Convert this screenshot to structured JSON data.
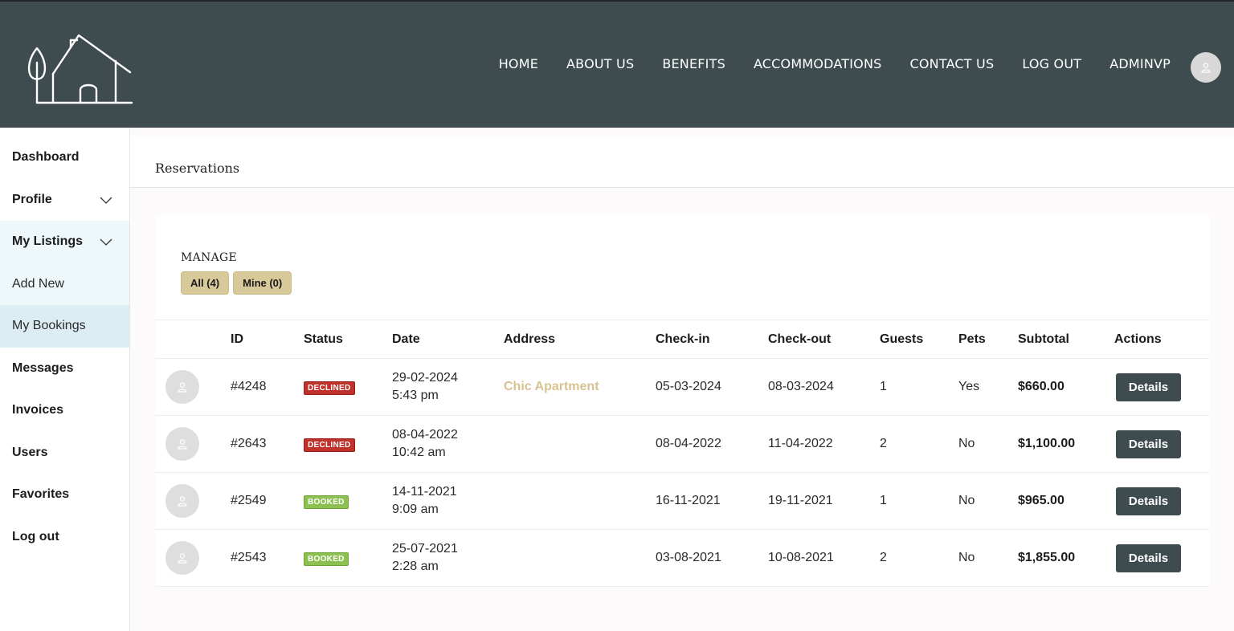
{
  "header": {
    "nav": [
      "HOME",
      "ABOUT US",
      "BENEFITS",
      "ACCOMMODATIONS",
      "CONTACT US",
      "LOG OUT",
      "ADMINVP"
    ]
  },
  "sidebar": {
    "items": [
      {
        "label": "Dashboard",
        "chevron": false
      },
      {
        "label": "Profile",
        "chevron": true
      },
      {
        "label": "My Listings",
        "chevron": true
      },
      {
        "label": "Add New",
        "chevron": false
      },
      {
        "label": "My Bookings",
        "chevron": false
      },
      {
        "label": "Messages",
        "chevron": false
      },
      {
        "label": "Invoices",
        "chevron": false
      },
      {
        "label": "Users",
        "chevron": false
      },
      {
        "label": "Favorites",
        "chevron": false
      },
      {
        "label": "Log out",
        "chevron": false
      }
    ]
  },
  "page": {
    "title": "Reservations",
    "manage_label": "MANAGE",
    "filters": [
      "All (4)",
      "Mine (0)"
    ]
  },
  "table": {
    "columns": [
      "",
      "ID",
      "Status",
      "Date",
      "Address",
      "Check-in",
      "Check-out",
      "Guests",
      "Pets",
      "Subtotal",
      "Actions"
    ],
    "rows": [
      {
        "id": "#4248",
        "status": "DECLINED",
        "status_type": "declined",
        "date": "29-02-2024",
        "time": "5:43 pm",
        "address": "Chic Apartment",
        "checkin": "05-03-2024",
        "checkout": "08-03-2024",
        "guests": "1",
        "pets": "Yes",
        "subtotal": "$660.00",
        "action": "Details"
      },
      {
        "id": "#2643",
        "status": "DECLINED",
        "status_type": "declined",
        "date": "08-04-2022",
        "time": "10:42 am",
        "address": "",
        "checkin": "08-04-2022",
        "checkout": "11-04-2022",
        "guests": "2",
        "pets": "No",
        "subtotal": "$1,100.00",
        "action": "Details"
      },
      {
        "id": "#2549",
        "status": "BOOKED",
        "status_type": "booked",
        "date": "14-11-2021",
        "time": "9:09 am",
        "address": "",
        "checkin": "16-11-2021",
        "checkout": "19-11-2021",
        "guests": "1",
        "pets": "No",
        "subtotal": "$965.00",
        "action": "Details"
      },
      {
        "id": "#2543",
        "status": "BOOKED",
        "status_type": "booked",
        "date": "25-07-2021",
        "time": "2:28 am",
        "address": "",
        "checkin": "03-08-2021",
        "checkout": "10-08-2021",
        "guests": "2",
        "pets": "No",
        "subtotal": "$1,855.00",
        "action": "Details"
      }
    ]
  },
  "colors": {
    "header_bg": "#3f4c4f",
    "accent_gold": "#d8c99a",
    "declined": "#c0312b",
    "booked": "#8cc152"
  }
}
